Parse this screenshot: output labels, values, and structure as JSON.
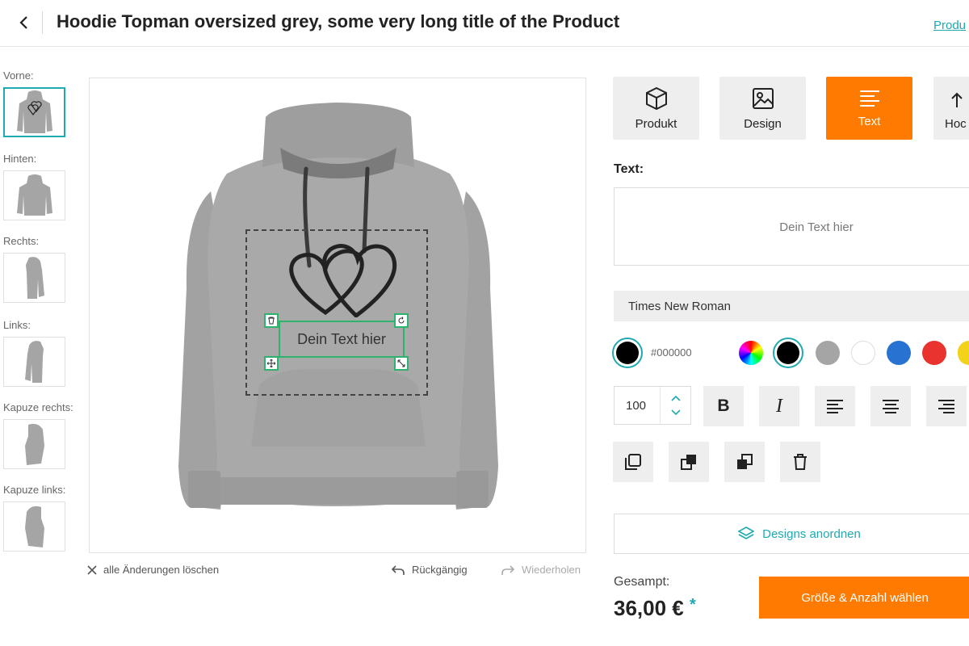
{
  "header": {
    "title": "Hoodie Topman oversized grey, some very long title of the Product",
    "link_label": "Produ"
  },
  "views": [
    {
      "label": "Vorne:",
      "active": true
    },
    {
      "label": "Hinten:",
      "active": false
    },
    {
      "label": "Rechts:",
      "active": false
    },
    {
      "label": "Links:",
      "active": false
    },
    {
      "label": "Kapuze rechts:",
      "active": false
    },
    {
      "label": "Kapuze links:",
      "active": false
    }
  ],
  "canvas": {
    "text_element": "Dein Text hier",
    "clear_label": "alle Änderungen löschen",
    "undo_label": "Rückgängig",
    "redo_label": "Wiederholen"
  },
  "tabs": [
    {
      "label": "Produkt",
      "icon": "cube-icon"
    },
    {
      "label": "Design",
      "icon": "image-icon"
    },
    {
      "label": "Text",
      "icon": "text-align-icon",
      "active": true
    },
    {
      "label": "Hoc",
      "icon": "upload-icon"
    }
  ],
  "text_panel": {
    "section_label": "Text:",
    "text_value": "Dein Text hier",
    "font": "Times New Roman",
    "current_color": "#000000",
    "hex_label": "#000000",
    "palette": [
      "#000000",
      "#a5a5a5",
      "#ffffff",
      "#2873d2",
      "#e8332f",
      "#f3d21a"
    ],
    "font_size": "100",
    "bold_label": "B",
    "italic_label": "I",
    "arrange_label": "Designs anordnen"
  },
  "summary": {
    "total_label": "Gesampt:",
    "price": "36,00 €",
    "price_note": "*",
    "cta_label": "Größe & Anzahl wählen"
  },
  "colors": {
    "accent": "#1fa9b0",
    "primary": "#ff7a00",
    "selection": "#2db36e",
    "hoodie": "#a5a5a5"
  }
}
